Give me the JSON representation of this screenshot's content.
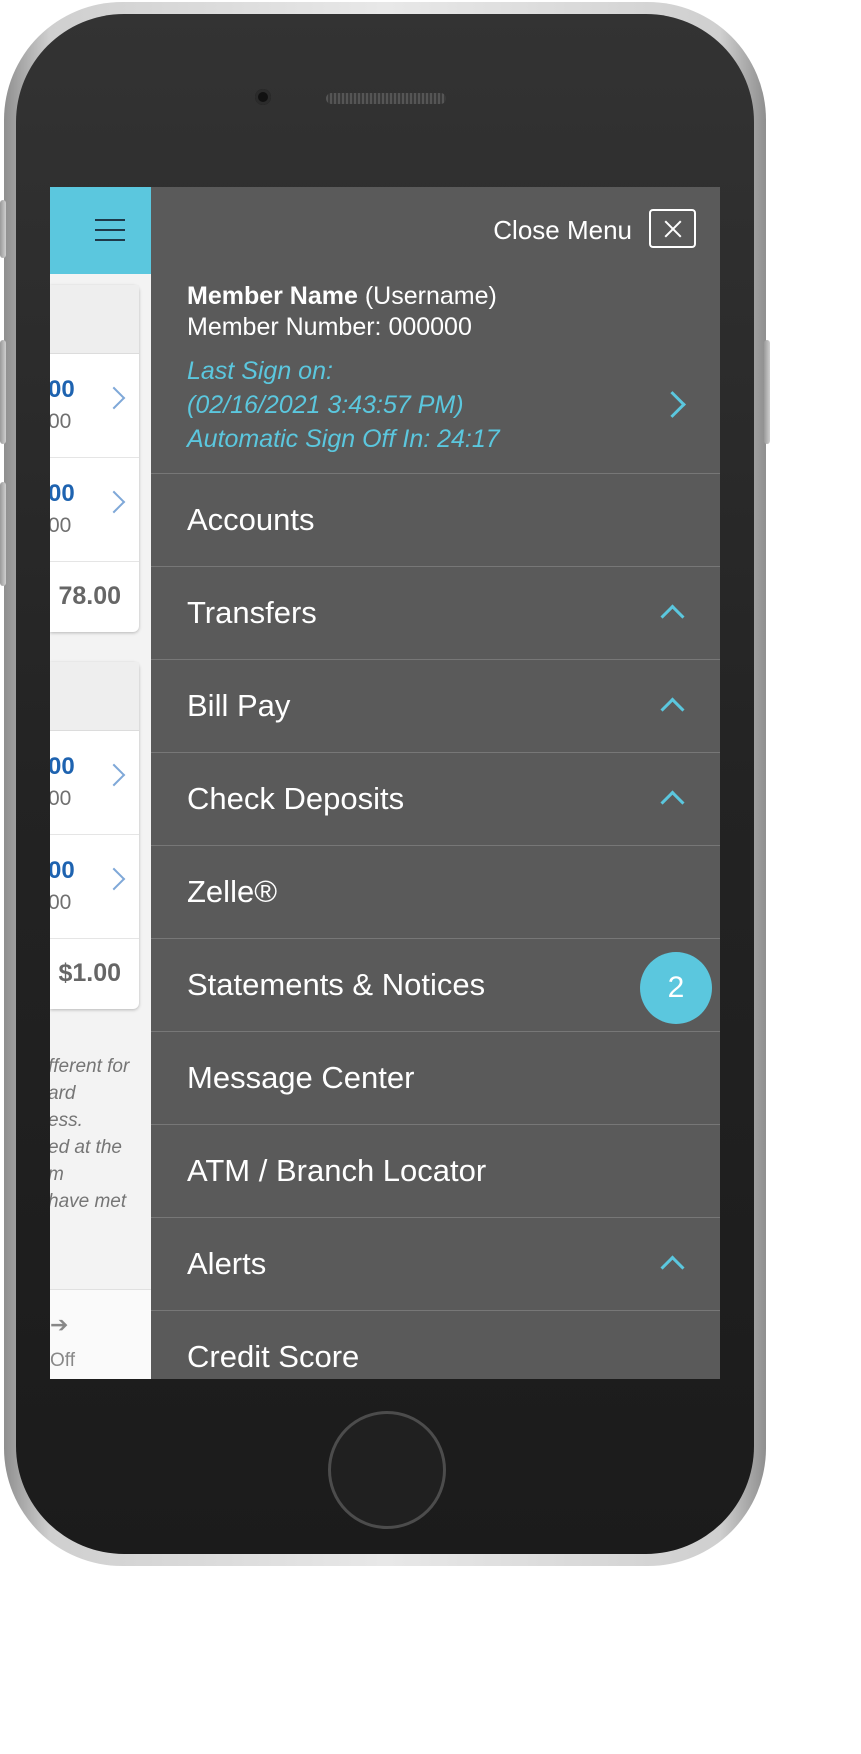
{
  "menu": {
    "close_label": "Close Menu",
    "member_name": "Member Name",
    "username": "(Username)",
    "member_number": "Member Number: 000000",
    "last_sign_on_label": "Last Sign on:",
    "last_sign_on_value": "(02/16/2021 3:43:57 PM)",
    "auto_sign_off": "Automatic Sign Off In: 24:17",
    "items": [
      {
        "label": "Accounts"
      },
      {
        "label": "Transfers"
      },
      {
        "label": "Bill Pay"
      },
      {
        "label": "Check Deposits"
      },
      {
        "label": "Zelle®"
      },
      {
        "label": "Statements & Notices",
        "badge": "2"
      },
      {
        "label": "Message Center"
      },
      {
        "label": "ATM / Branch Locator"
      },
      {
        "label": "Alerts"
      },
      {
        "label": "Credit Score"
      }
    ]
  },
  "background_app": {
    "card1": {
      "rows": [
        {
          "amount": "00",
          "sub": "00"
        },
        {
          "amount": "00",
          "sub": "00"
        }
      ],
      "total": "78.00"
    },
    "card2": {
      "rows": [
        {
          "amount": "00",
          "sub": "00"
        },
        {
          "amount": "00",
          "sub": "00"
        }
      ],
      "total": "$1.00"
    },
    "disclaimer_lines": [
      "fferent for",
      "ard",
      "ess.",
      "ed at the",
      "m",
      "have met"
    ],
    "bottom_label": "Off"
  },
  "colors": {
    "accent": "#5bc7de",
    "menu_bg": "#5a5a5a",
    "amount_blue": "#1e63b0"
  }
}
